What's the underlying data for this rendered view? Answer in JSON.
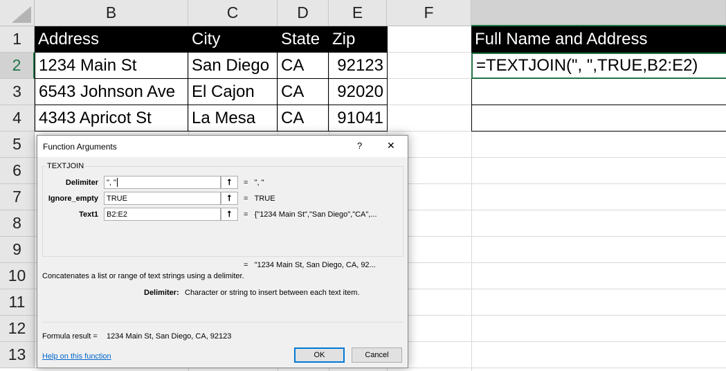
{
  "columns": [
    "B",
    "C",
    "D",
    "E",
    "F",
    ""
  ],
  "rows": [
    "1",
    "2",
    "3",
    "4",
    "5",
    "6",
    "7",
    "8",
    "9",
    "10",
    "11",
    "12",
    "13"
  ],
  "table": {
    "headers": [
      "Address",
      "City",
      "State",
      "Zip"
    ],
    "data": [
      [
        "1234 Main St",
        "San Diego",
        "CA",
        "92123"
      ],
      [
        "6543 Johnson Ave",
        "El Cajon",
        "CA",
        "92020"
      ],
      [
        "4343 Apricot St",
        "La Mesa",
        "CA",
        "91041"
      ]
    ]
  },
  "g": {
    "header": "Full Name and Address",
    "formula": "=TEXTJOIN(\", \",TRUE,B2:E2)"
  },
  "dialog": {
    "title": "Function Arguments",
    "help_glyph": "?",
    "close_glyph": "✕",
    "function_name": "TEXTJOIN",
    "args": [
      {
        "label": "Delimiter",
        "value": "\", \"",
        "result": "\", \""
      },
      {
        "label": "Ignore_empty",
        "value": "TRUE",
        "result": "TRUE"
      },
      {
        "label": "Text1",
        "value": "B2:E2",
        "result": "{\"1234 Main St\",\"San Diego\",\"CA\",..."
      }
    ],
    "collapse_glyph": "⭡",
    "eq": "=",
    "overall_result": "\"1234 Main St, San Diego, CA, 92...",
    "description": "Concatenates a list or range of text strings using a delimiter.",
    "arg_help_label": "Delimiter:",
    "arg_help_text": "Character or string to insert between each text item.",
    "formula_result_label": "Formula result =",
    "formula_result": "1234 Main St, San Diego, CA, 92123",
    "help_link": "Help on this function",
    "ok": "OK",
    "cancel": "Cancel"
  },
  "colors": {
    "accent": "#217346",
    "header_bg": "#000000",
    "link": "#0066cc"
  }
}
